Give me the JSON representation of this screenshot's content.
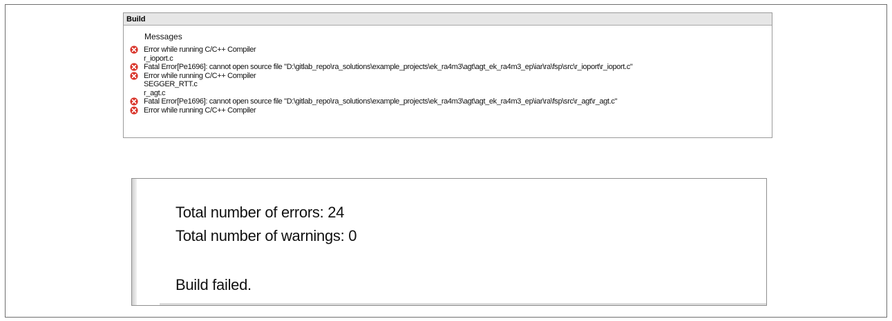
{
  "build_window": {
    "title": "Build",
    "messages_header": "Messages",
    "messages": [
      {
        "icon": "error-icon",
        "text": "Error while running C/C++ Compiler"
      },
      {
        "icon": "",
        "text": "r_ioport.c"
      },
      {
        "icon": "error-icon",
        "text": "Fatal Error[Pe1696]: cannot open source file \"D:\\gitlab_repo\\ra_solutions\\example_projects\\ek_ra4m3\\agt\\agt_ek_ra4m3_ep\\iar\\ra\\fsp\\src\\r_ioport\\r_ioport.c\""
      },
      {
        "icon": "error-icon",
        "text": "Error while running C/C++ Compiler"
      },
      {
        "icon": "",
        "text": "SEGGER_RTT.c"
      },
      {
        "icon": "",
        "text": "r_agt.c"
      },
      {
        "icon": "error-icon",
        "text": "Fatal Error[Pe1696]: cannot open source file \"D:\\gitlab_repo\\ra_solutions\\example_projects\\ek_ra4m3\\agt\\agt_ek_ra4m3_ep\\iar\\ra\\fsp\\src\\r_agt\\r_agt.c\""
      },
      {
        "icon": "error-icon",
        "text": "Error while running C/C++ Compiler"
      }
    ]
  },
  "summary": {
    "errors": "Total number of errors: 24",
    "warnings": "Total number of warnings: 0",
    "status": "Build failed."
  },
  "colors": {
    "error_red": "#d9352b",
    "title_bar": "#e6e6e6"
  }
}
